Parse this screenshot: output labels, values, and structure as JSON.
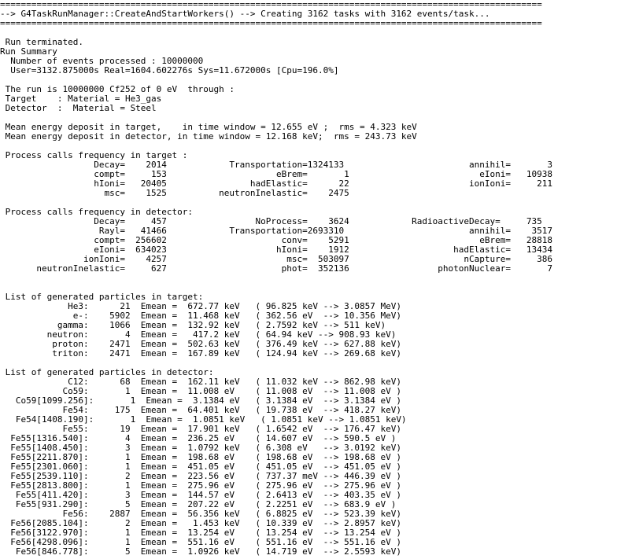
{
  "terminal": {
    "lines": [
      "========================================================================================================",
      "--> G4TaskRunManager::CreateAndStartWorkers() --> Creating 3162 tasks with 3162 events/task...",
      "========================================================================================================",
      "",
      " Run terminated.",
      "Run Summary",
      "  Number of events processed : 10000000",
      "  User=3132.875000s Real=1604.602276s Sys=11.672000s [Cpu=196.0%]",
      "",
      " The run is 10000000 Cf252 of 0 eV  through :",
      " Target    : Material = He3_gas",
      " Detector  :  Material = Steel",
      "",
      " Mean energy deposit in target,    in time window = 12.655 eV ;  rms = 4.323 keV",
      " Mean energy deposit in detector, in time window = 12.168 keV;  rms = 243.73 keV",
      "",
      " Process calls frequency in target :",
      "                  Decay=    2014            Transportation=1324133                        annihil=       3",
      "                  compt=     153                     eBrem=       1                         eIoni=   10938",
      "                  hIoni=   20405                hadElastic=      22                       ionIoni=     211",
      "                    msc=    1525          neutronInelastic=    2475",
      "",
      " Process calls frequency in detector:",
      "                  Decay=     457                 NoProcess=    3624            RadioactiveDecay=     735",
      "                   Rayl=   41466            Transportation=2693310                        annihil=    3517",
      "                  compt=  256602                      conv=    5291                         eBrem=   28818",
      "                  eIoni=  634023                     hIoni=    1912                    hadElastic=   13434",
      "                ionIoni=    4257                       msc=  503097                      nCapture=     386",
      "       neutronInelastic=     627                      phot=  352136                 photonNuclear=       7",
      "",
      "",
      " List of generated particles in target:",
      "             He3:      21  Emean =  672.77 keV   ( 96.825 keV --> 3.0857 MeV)",
      "              e-:    5902  Emean =  11.468 keV   ( 362.56 eV  --> 10.356 MeV)",
      "           gamma:    1066  Emean =  132.92 keV   ( 2.7592 keV --> 511 keV)",
      "         neutron:       4  Emean =   417.2 keV   ( 64.94 keV --> 908.93 keV)",
      "          proton:    2471  Emean =  502.63 keV   ( 376.49 keV --> 627.88 keV)",
      "          triton:    2471  Emean =  167.89 keV   ( 124.94 keV --> 269.68 keV)",
      "",
      " List of generated particles in detector:",
      "             C12:      68  Emean =  162.11 keV   ( 11.032 keV --> 862.98 keV)",
      "            Co59:       1  Emean =  11.008 eV    ( 11.008 eV  --> 11.008 eV )",
      "   Co59[1099.256]:       1  Emean =  3.1384 eV   ( 3.1384 eV  --> 3.1384 eV )",
      "            Fe54:     175  Emean =  64.401 keV   ( 19.738 eV  --> 418.27 keV)",
      "   Fe54[1408.190]:       1  Emean =  1.0851 keV   ( 1.0851 keV --> 1.0851 keV)",
      "            Fe55:      19  Emean =  17.901 keV   ( 1.6542 eV  --> 176.47 keV)",
      "  Fe55[1316.540]:       4  Emean =  236.25 eV    ( 14.607 eV  --> 590.5 eV )",
      "  Fe55[1408.450]:       3  Emean =  1.0792 keV   ( 6.308 eV   --> 3.0192 keV)",
      "  Fe55[2211.870]:       1  Emean =  198.68 eV    ( 198.68 eV  --> 198.68 eV )",
      "  Fe55[2301.060]:       1  Emean =  451.05 eV    ( 451.05 eV  --> 451.05 eV )",
      "  Fe55[2539.110]:       2  Emean =  223.56 eV    ( 737.37 meV --> 446.39 eV )",
      "  Fe55[2813.800]:       1  Emean =  275.96 eV    ( 275.96 eV  --> 275.96 eV )",
      "   Fe55[411.420]:       3  Emean =  144.57 eV    ( 2.6413 eV  --> 403.35 eV )",
      "   Fe55[931.290]:       5  Emean =  207.22 eV    ( 2.2251 eV  --> 683.9 eV )",
      "            Fe56:    2887  Emean =  56.356 keV   ( 6.8825 eV  --> 523.39 keV)",
      "  Fe56[2085.104]:       2  Emean =   1.453 keV   ( 10.339 eV  --> 2.8957 keV)",
      "  Fe56[3122.970]:       1  Emean =  13.254 eV    ( 13.254 eV  --> 13.254 eV )",
      "  Fe56[4298.096]:       1  Emean =  551.16 eV    ( 551.16 eV  --> 551.16 eV )",
      "   Fe56[846.778]:       5  Emean =  1.0926 keV   ( 14.719 eV  --> 2.5593 keV)"
    ]
  }
}
